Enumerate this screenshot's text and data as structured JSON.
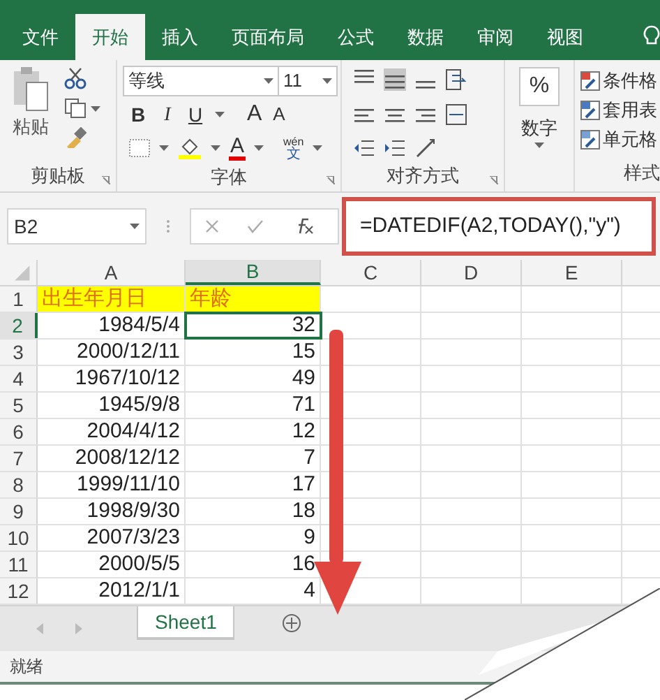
{
  "ribbon_tabs": [
    {
      "label": "文件",
      "selected": false
    },
    {
      "label": "开始",
      "selected": true
    },
    {
      "label": "插入",
      "selected": false
    },
    {
      "label": "页面布局",
      "selected": false
    },
    {
      "label": "公式",
      "selected": false
    },
    {
      "label": "数据",
      "selected": false
    },
    {
      "label": "审阅",
      "selected": false
    },
    {
      "label": "视图",
      "selected": false
    }
  ],
  "ribbon": {
    "clipboard": {
      "paste": "粘贴",
      "group_label": "剪贴板"
    },
    "font": {
      "font_name": "等线",
      "font_size": "11",
      "bold": "B",
      "italic": "I",
      "underline": "U",
      "grow": "A",
      "shrink": "A",
      "font_color": "A",
      "phonetic_top": "wén",
      "phonetic_bottom": "文",
      "group_label": "字体"
    },
    "alignment": {
      "group_label": "对齐方式"
    },
    "number": {
      "symbol": "%",
      "label": "数字"
    },
    "styles": {
      "items": [
        "条件格",
        "套用表",
        "单元格"
      ],
      "group_label": "样式"
    }
  },
  "formula_bar": {
    "name_box": "B2",
    "formula": "=DATEDIF(A2,TODAY(),\"y\")"
  },
  "sheet": {
    "columns": [
      {
        "label": "A",
        "selected": false
      },
      {
        "label": "B",
        "selected": true
      },
      {
        "label": "C",
        "selected": false
      },
      {
        "label": "D",
        "selected": false
      },
      {
        "label": "E",
        "selected": false
      }
    ],
    "rows": [
      {
        "label": "1",
        "kind": "header",
        "selected": false,
        "cells": [
          "出生年月日",
          "年龄"
        ]
      },
      {
        "label": "2",
        "kind": "data",
        "selected": true,
        "cells": [
          "1984/5/4",
          "32"
        ]
      },
      {
        "label": "3",
        "kind": "data",
        "selected": false,
        "cells": [
          "2000/12/11",
          "15"
        ]
      },
      {
        "label": "4",
        "kind": "data",
        "selected": false,
        "cells": [
          "1967/10/12",
          "49"
        ]
      },
      {
        "label": "5",
        "kind": "data",
        "selected": false,
        "cells": [
          "1945/9/8",
          "71"
        ]
      },
      {
        "label": "6",
        "kind": "data",
        "selected": false,
        "cells": [
          "2004/4/12",
          "12"
        ]
      },
      {
        "label": "7",
        "kind": "data",
        "selected": false,
        "cells": [
          "2008/12/12",
          "7"
        ]
      },
      {
        "label": "8",
        "kind": "data",
        "selected": false,
        "cells": [
          "1999/11/10",
          "17"
        ]
      },
      {
        "label": "9",
        "kind": "data",
        "selected": false,
        "cells": [
          "1998/9/30",
          "18"
        ]
      },
      {
        "label": "10",
        "kind": "data",
        "selected": false,
        "cells": [
          "2007/3/23",
          "9"
        ]
      },
      {
        "label": "11",
        "kind": "data",
        "selected": false,
        "cells": [
          "2000/5/5",
          "16"
        ]
      },
      {
        "label": "12",
        "kind": "data",
        "selected": false,
        "cells": [
          "2012/1/1",
          "4"
        ]
      }
    ]
  },
  "sheet_tabs": [
    {
      "label": "Sheet1",
      "selected": true
    }
  ],
  "status_bar": {
    "text": "就绪"
  }
}
